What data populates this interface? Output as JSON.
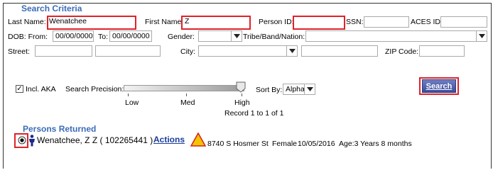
{
  "search": {
    "section_title": "Search Criteria",
    "last_name_label": "Last Name:",
    "last_name_value": "Wenatchee",
    "first_name_label": "First Name:",
    "first_name_value": "Z",
    "person_id_label": "Person ID:",
    "person_id_value": "",
    "ssn_label": "SSN:",
    "ssn_value": "",
    "aces_id_label": "ACES ID:",
    "aces_id_value": "",
    "dob_from_label": "DOB: From:",
    "dob_from_value": "00/00/0000",
    "dob_to_label": "To:",
    "dob_to_value": "00/00/0000",
    "gender_label": "Gender:",
    "gender_value": "",
    "tribe_label": "Tribe/Band/Nation:",
    "tribe_value": "",
    "street_label": "Street:",
    "city_label": "City:",
    "zip_label": "ZIP Code:",
    "incl_aka_label": "Incl. AKA",
    "incl_aka_checked": true,
    "precision_label": "Search Precision:",
    "precision_ticks": [
      "Low",
      "Med",
      "High"
    ],
    "precision_level": "High",
    "sort_by_label": "Sort By:",
    "sort_by_value": "Alpha",
    "search_button": "Search",
    "record_info": "Record 1 to 1 of 1"
  },
  "results": {
    "section_title": "Persons Returned",
    "row": {
      "selected": true,
      "name": "Wenatchee, Z Z ( 102265441 )",
      "actions_label": "Actions",
      "address": "8740 S Hosmer St",
      "gender": "Female",
      "dob": "10/05/2016",
      "age": "Age:3 Years 8 months"
    }
  },
  "colors": {
    "section_title": "#3b6cb7",
    "highlight": "#e0222a",
    "button": "#3b4b9b",
    "warning": "#f5c400"
  }
}
